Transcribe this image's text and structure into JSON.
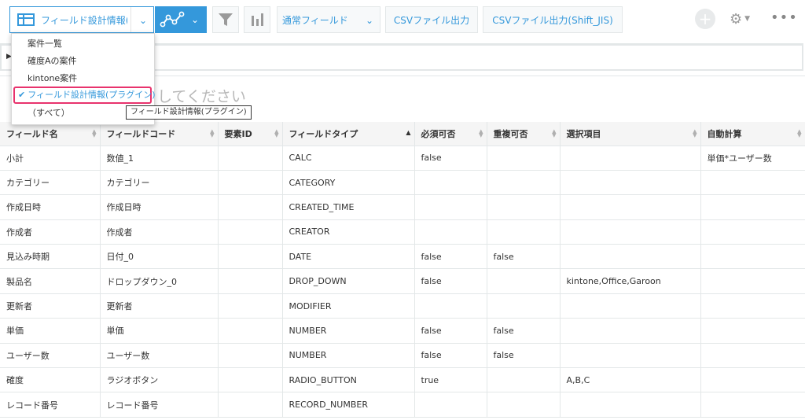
{
  "toolbar": {
    "view_select_label": "フィールド設計情報(…",
    "field_mode_label": "通常フィールド",
    "csv_export_label": "CSVファイル出力",
    "csv_export_sjis_label": "CSVファイル出力(Shift_JIS)",
    "plus_label": "+",
    "more_label": "•••"
  },
  "dropdown": {
    "items": [
      {
        "label": "案件一覧"
      },
      {
        "label": "確度Aの案件"
      },
      {
        "label": "kintone案件"
      },
      {
        "label": "フィールド設計情報(プラグイン)",
        "selected": true
      },
      {
        "label": "（すべて）"
      }
    ],
    "tooltip": "フィールド設計情報(プラグイン)"
  },
  "placeholder": "してください",
  "table": {
    "columns": [
      "フィールド名",
      "フィールドコード",
      "要素ID",
      "フィールドタイプ",
      "必須可否",
      "重複可否",
      "選択項目",
      "自動計算"
    ],
    "rows": [
      [
        "小計",
        "数値_1",
        "",
        "CALC",
        "false",
        "",
        "",
        "単価*ユーザー数"
      ],
      [
        "カテゴリー",
        "カテゴリー",
        "",
        "CATEGORY",
        "",
        "",
        "",
        ""
      ],
      [
        "作成日時",
        "作成日時",
        "",
        "CREATED_TIME",
        "",
        "",
        "",
        ""
      ],
      [
        "作成者",
        "作成者",
        "",
        "CREATOR",
        "",
        "",
        "",
        ""
      ],
      [
        "見込み時期",
        "日付_0",
        "",
        "DATE",
        "false",
        "false",
        "",
        ""
      ],
      [
        "製品名",
        "ドロップダウン_0",
        "",
        "DROP_DOWN",
        "false",
        "",
        "kintone,Office,Garoon",
        ""
      ],
      [
        "更新者",
        "更新者",
        "",
        "MODIFIER",
        "",
        "",
        "",
        ""
      ],
      [
        "単価",
        "単価",
        "",
        "NUMBER",
        "false",
        "false",
        "",
        ""
      ],
      [
        "ユーザー数",
        "ユーザー数",
        "",
        "NUMBER",
        "false",
        "false",
        "",
        ""
      ],
      [
        "確度",
        "ラジオボタン",
        "",
        "RADIO_BUTTON",
        "true",
        "",
        "A,B,C",
        ""
      ],
      [
        "レコード番号",
        "レコード番号",
        "",
        "RECORD_NUMBER",
        "",
        "",
        "",
        ""
      ]
    ]
  },
  "colors": {
    "accent": "#3498db",
    "highlight": "#e8336d"
  }
}
